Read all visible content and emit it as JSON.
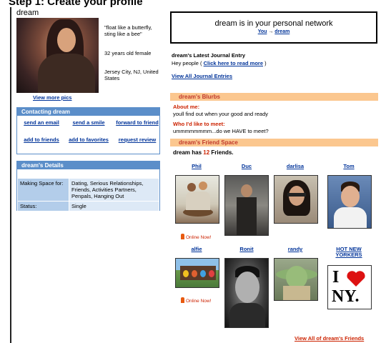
{
  "page": {
    "heading": "Step 1: Create your profile"
  },
  "profile": {
    "name": "dream",
    "quote": "\"float like a butterfly, sting like a bee\"",
    "age_gender": "32 years old female",
    "location": "Jersey City, NJ, United States",
    "view_more_pics": "View more pics"
  },
  "contact": {
    "title": "Contacting dream",
    "actions": [
      "send an email",
      "send a smile",
      "forward to friend",
      "add to friends",
      "add to favorites",
      "request review"
    ]
  },
  "details": {
    "title": "dream's Details",
    "rows": [
      {
        "label": "Making Space for:",
        "value": "Dating, Serious Relationships, Friends, Activities Partners, Penpals, Hanging Out"
      },
      {
        "label": "Status:",
        "value": "Single"
      }
    ]
  },
  "network": {
    "message": "dream is in your personal network",
    "you": "You",
    "arrow": "→",
    "dream": "dream"
  },
  "journal": {
    "title": "dream's Latest Journal Entry",
    "entry_prefix": "Hey people (",
    "read_more": "Click here to read more",
    "entry_suffix": ")",
    "view_all": "View All Journal Entries"
  },
  "blurbs": {
    "title": "dream's Blurbs",
    "about_label": "About me:",
    "about_text": "youll find out when your good and ready",
    "meet_label": "Who I'd like to meet:",
    "meet_text": "ummmmmmmm...do we HAVE to meet?"
  },
  "friends": {
    "title": "dream's Friend Space",
    "count_prefix": "dream has",
    "count": "12",
    "count_suffix": "Friends.",
    "online_label": "Online Now!",
    "list": [
      {
        "name": "Phil"
      },
      {
        "name": "Duc"
      },
      {
        "name": "darlisa"
      },
      {
        "name": "Tom"
      },
      {
        "name": "alfie"
      },
      {
        "name": "Ronit"
      },
      {
        "name": "randy"
      },
      {
        "name": "HOT NEW YORKERS"
      }
    ],
    "nyc_logo": {
      "i": "I",
      "heart_color": "#d11",
      "ny": "NY."
    },
    "view_all": "View All of dream's Friends"
  },
  "colors": {
    "blue_accent": "#5b8ec9",
    "orange_bar": "#fbc78f",
    "red_text": "#cc2200",
    "link_blue": "#003399"
  }
}
